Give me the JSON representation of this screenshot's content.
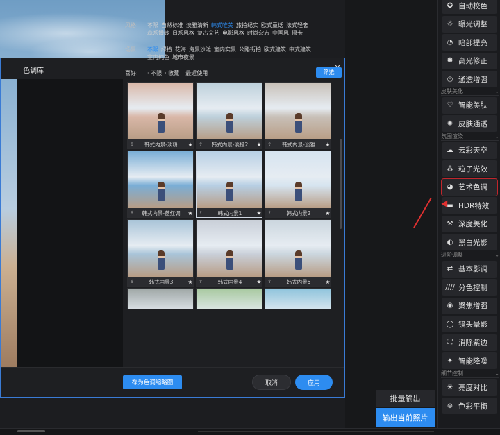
{
  "dialog": {
    "title": "色调库",
    "close": "×",
    "filters": {
      "style": {
        "label": "风格:",
        "options": [
          "不限",
          "自然标准",
          "淡雅清新",
          "韩式唯美",
          "旅拍纪实",
          "欧式童话",
          "法式轻奢",
          "森系婚纱",
          "日系风格",
          "复古文艺",
          "电影风格",
          "时尚杂志",
          "中国风",
          "摄卡"
        ],
        "active_index": 3
      },
      "scene": {
        "label": "场景:",
        "options": [
          "不限",
          "绿植",
          "花海",
          "海景沙滩",
          "室内实景",
          "公路街拍",
          "欧式建筑",
          "中式建筑",
          "室内纯色",
          "城市夜景"
        ],
        "active_index": 0
      },
      "like": {
        "label": "喜好:",
        "options": [
          "· 不限",
          "· 收藏",
          "· 最近使用"
        ]
      },
      "filter_button": "筛选"
    },
    "presets": [
      {
        "name": "韩式内景-淡粉",
        "tint": "#d9b7a8"
      },
      {
        "name": "韩式内景-淡橙2",
        "tint": "#bdd0db"
      },
      {
        "name": "韩式内景-淡雅",
        "tint": "#c8c0b8"
      },
      {
        "name": "韩式内景-蓝红调",
        "tint": "#7aaed6"
      },
      {
        "name": "韩式内景1",
        "tint": "#b7cfe4"
      },
      {
        "name": "韩式内景2",
        "tint": "#d6e4f0"
      },
      {
        "name": "韩式内景3",
        "tint": "#a9c4d8"
      },
      {
        "name": "韩式内景4",
        "tint": "#c9cfd8"
      },
      {
        "name": "韩式内景5",
        "tint": "#cbd6de"
      },
      {
        "name": "",
        "tint": "#9fa7a6"
      },
      {
        "name": "",
        "tint": "#a8c9a0"
      },
      {
        "name": "",
        "tint": "#8fc4dc"
      }
    ],
    "selected_index": 4,
    "save_preset": "存为色调缩略图",
    "cancel": "取消",
    "apply": "应用"
  },
  "right_panel": {
    "items": [
      {
        "label": "自动校色",
        "icon": "auto-color-icon",
        "glyph": "✪"
      },
      {
        "label": "曝光调整",
        "icon": "sun-icon",
        "glyph": "☼"
      },
      {
        "label": "暗部提亮",
        "icon": "shadow-icon",
        "glyph": "◔"
      },
      {
        "label": "高光修正",
        "icon": "highlight-icon",
        "glyph": "✱"
      },
      {
        "label": "通透增强",
        "icon": "clarity-icon",
        "glyph": "◎"
      }
    ],
    "section_skin": "皮肤美化",
    "skin_items": [
      {
        "label": "智能美肤",
        "icon": "shield-icon",
        "glyph": "♡"
      },
      {
        "label": "皮肤通透",
        "icon": "skin-icon",
        "glyph": "✺"
      }
    ],
    "section_atmos": "氛围渲染",
    "atmos_items": [
      {
        "label": "云彩天空",
        "icon": "cloud-icon",
        "glyph": "☁"
      },
      {
        "label": "粒子光效",
        "icon": "particle-icon",
        "glyph": "⁂"
      },
      {
        "label": "艺术色调",
        "icon": "palette-icon",
        "glyph": "◕"
      },
      {
        "label": "HDR特效",
        "icon": "hdr-icon",
        "glyph": "▬"
      },
      {
        "label": "深度美化",
        "icon": "magic-wand-icon",
        "glyph": "⚒"
      },
      {
        "label": "黑白光影",
        "icon": "bw-icon",
        "glyph": "◐"
      }
    ],
    "section_adv": "进阶调整",
    "adv_items": [
      {
        "label": "基本影调",
        "icon": "sliders-icon",
        "glyph": "⇄"
      },
      {
        "label": "分色控制",
        "icon": "split-tone-icon",
        "glyph": "////"
      },
      {
        "label": "聚焦增强",
        "icon": "focus-icon",
        "glyph": "◉"
      },
      {
        "label": "镜头晕影",
        "icon": "vignette-icon",
        "glyph": "◯"
      },
      {
        "label": "消除紫边",
        "icon": "fringe-icon",
        "glyph": "⛶"
      },
      {
        "label": "智能降噪",
        "icon": "denoise-icon",
        "glyph": "✦"
      }
    ],
    "section_detail": "细节控制",
    "detail_items": [
      {
        "label": "亮度对比",
        "icon": "contrast-icon",
        "glyph": "☀"
      },
      {
        "label": "色彩平衡",
        "icon": "balance-icon",
        "glyph": "⊜"
      }
    ]
  },
  "output": {
    "batch": "批量输出",
    "current": "输出当前照片"
  }
}
